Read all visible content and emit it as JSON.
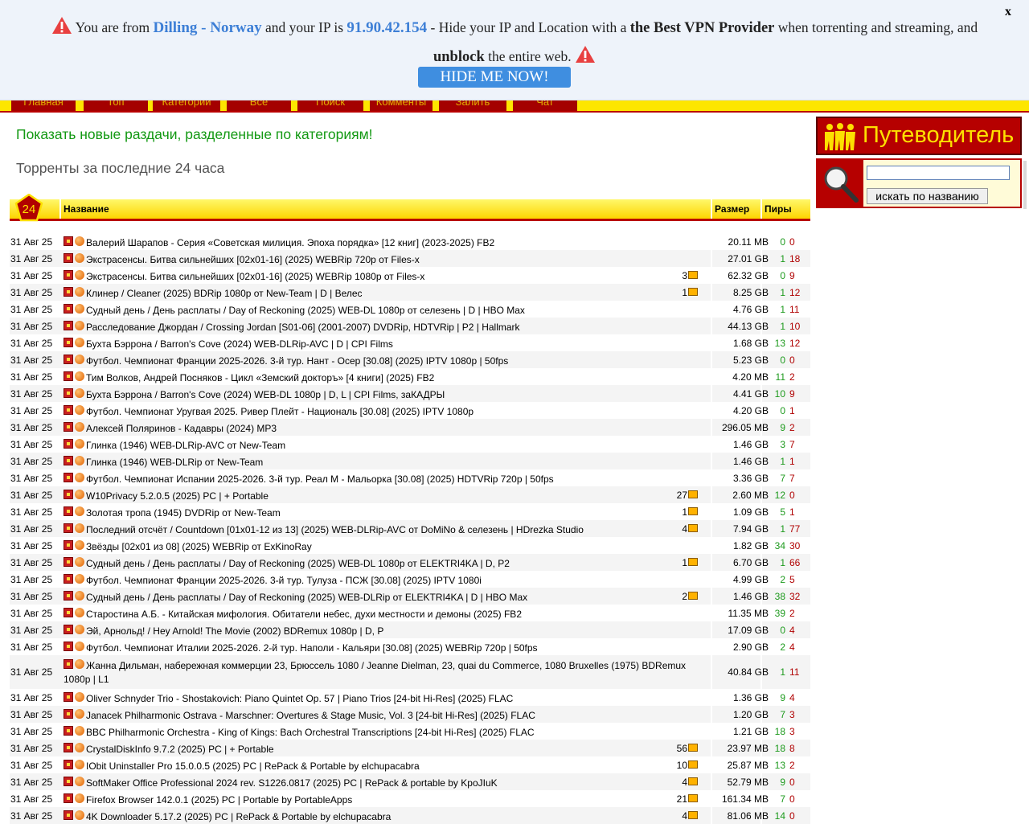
{
  "banner": {
    "part1": "You are from",
    "location": "Dilling - Norway",
    "part2": "and your IP is",
    "ip": "91.90.42.154",
    "part3": "- Hide your IP and Location with a",
    "provider": "the Best VPN Provider",
    "part4": "when torrenting and streaming, and",
    "unblock": "unblock",
    "part5": "the entire web.",
    "button": "HIDE ME NOW!",
    "close": "x"
  },
  "nav": [
    "Главная",
    "Топ",
    "Категории",
    "Все",
    "Поиск",
    "Комменты",
    "Залить",
    "Чат"
  ],
  "main": {
    "new_by_category": "Показать новые раздачи, разделенные по категориям!",
    "heading": "Торренты за последние 24 часа"
  },
  "table": {
    "badge": "24",
    "col_name": "Название",
    "col_size": "Размер",
    "col_peers": "Пиры",
    "rows": [
      {
        "date": "31 Авг 25",
        "title": "Валерий Шарапов - Серия «Советская милиция. Эпоха порядка» [12 книг] (2023-2025) FB2",
        "comments": "",
        "size": "20.11 MB",
        "seed": "0",
        "leech": "0"
      },
      {
        "date": "31 Авг 25",
        "title": "Экстрасенсы. Битва сильнейших [02x01-16] (2025) WEBRip 720p от Files-x",
        "comments": "",
        "size": "27.01 GB",
        "seed": "1",
        "leech": "18"
      },
      {
        "date": "31 Авг 25",
        "title": "Экстрасенсы. Битва сильнейших [02x01-16] (2025) WEBRip 1080p от Files-x",
        "comments": "3",
        "size": "62.32 GB",
        "seed": "0",
        "leech": "9"
      },
      {
        "date": "31 Авг 25",
        "title": "Клинер / Cleaner (2025) BDRip 1080p от New-Team | D | Велес",
        "comments": "1",
        "size": "8.25 GB",
        "seed": "1",
        "leech": "12"
      },
      {
        "date": "31 Авг 25",
        "title": "Судный день / День расплаты / Day of Reckoning (2025) WEB-DL 1080p от селезень | D | HBO Max",
        "comments": "",
        "size": "4.76 GB",
        "seed": "1",
        "leech": "11"
      },
      {
        "date": "31 Авг 25",
        "title": "Расследование Джордан / Crossing Jordan [S01-06] (2001-2007) DVDRip, HDTVRip | P2 | Hallmark",
        "comments": "",
        "size": "44.13 GB",
        "seed": "1",
        "leech": "10"
      },
      {
        "date": "31 Авг 25",
        "title": "Бухта Бэррона / Barron's Cove (2024) WEB-DLRip-AVC | D | CPI Films",
        "comments": "",
        "size": "1.68 GB",
        "seed": "13",
        "leech": "12"
      },
      {
        "date": "31 Авг 25",
        "title": "Футбол. Чемпионат Франции 2025-2026. 3-й тур. Нант - Осер [30.08] (2025) IPTV 1080p | 50fps",
        "comments": "",
        "size": "5.23 GB",
        "seed": "0",
        "leech": "0"
      },
      {
        "date": "31 Авг 25",
        "title": "Тим Волков, Андрей Посняков - Цикл «Земский докторъ» [4 книги] (2025) FB2",
        "comments": "",
        "size": "4.20 MB",
        "seed": "11",
        "leech": "2"
      },
      {
        "date": "31 Авг 25",
        "title": "Бухта Бэррона / Barron's Cove (2024) WEB-DL 1080p | D, L | CPI Films, заКАДРЫ",
        "comments": "",
        "size": "4.41 GB",
        "seed": "10",
        "leech": "9"
      },
      {
        "date": "31 Авг 25",
        "title": "Футбол. Чемпионат Уругвая 2025. Ривер Плейт - Националь [30.08] (2025) IPTV 1080p",
        "comments": "",
        "size": "4.20 GB",
        "seed": "0",
        "leech": "1"
      },
      {
        "date": "31 Авг 25",
        "title": "Алексей Поляринов - Кадавры (2024) MP3",
        "comments": "",
        "size": "296.05 MB",
        "seed": "9",
        "leech": "2"
      },
      {
        "date": "31 Авг 25",
        "title": "Глинка (1946) WEB-DLRip-AVC от New-Team",
        "comments": "",
        "size": "1.46 GB",
        "seed": "3",
        "leech": "7"
      },
      {
        "date": "31 Авг 25",
        "title": "Глинка (1946) WEB-DLRip от New-Team",
        "comments": "",
        "size": "1.46 GB",
        "seed": "1",
        "leech": "1"
      },
      {
        "date": "31 Авг 25",
        "title": "Футбол. Чемпионат Испании 2025-2026. 3-й тур. Реал М - Мальорка [30.08] (2025) HDTVRip 720p | 50fps",
        "comments": "",
        "size": "3.36 GB",
        "seed": "7",
        "leech": "7"
      },
      {
        "date": "31 Авг 25",
        "title": "W10Privacy 5.2.0.5 (2025) PC | + Portable",
        "comments": "27",
        "size": "2.60 MB",
        "seed": "12",
        "leech": "0"
      },
      {
        "date": "31 Авг 25",
        "title": "Золотая тропа (1945) DVDRip от New-Team",
        "comments": "1",
        "size": "1.09 GB",
        "seed": "5",
        "leech": "1"
      },
      {
        "date": "31 Авг 25",
        "title": "Последний отсчёт / Countdown [01x01-12 из 13] (2025) WEB-DLRip-AVC от DoMiNo & селезень | HDrezka Studio",
        "comments": "4",
        "size": "7.94 GB",
        "seed": "1",
        "leech": "77"
      },
      {
        "date": "31 Авг 25",
        "title": "Звёзды [02x01 из 08] (2025) WEBRip от ExKinoRay",
        "comments": "",
        "size": "1.82 GB",
        "seed": "34",
        "leech": "30"
      },
      {
        "date": "31 Авг 25",
        "title": "Судный день / День расплаты / Day of Reckoning (2025) WEB-DL 1080p от ELEKTRI4KA | D, P2",
        "comments": "1",
        "size": "6.70 GB",
        "seed": "1",
        "leech": "66"
      },
      {
        "date": "31 Авг 25",
        "title": "Футбол. Чемпионат Франции 2025-2026. 3-й тур. Тулуза - ПСЖ [30.08] (2025) IPTV 1080i",
        "comments": "",
        "size": "4.99 GB",
        "seed": "2",
        "leech": "5"
      },
      {
        "date": "31 Авг 25",
        "title": "Судный день / День расплаты / Day of Reckoning (2025) WEB-DLRip от ELEKTRI4KA | D | HBO Max",
        "comments": "2",
        "size": "1.46 GB",
        "seed": "38",
        "leech": "32"
      },
      {
        "date": "31 Авг 25",
        "title": "Старостина А.Б. - Китайская мифология. Обитатели небес, духи местности и демоны (2025) FB2",
        "comments": "",
        "size": "11.35 MB",
        "seed": "39",
        "leech": "2"
      },
      {
        "date": "31 Авг 25",
        "title": "Эй, Арнольд! / Hey Arnold! The Movie (2002) BDRemux 1080p | D, P",
        "comments": "",
        "size": "17.09 GB",
        "seed": "0",
        "leech": "4"
      },
      {
        "date": "31 Авг 25",
        "title": "Футбол. Чемпионат Италии 2025-2026. 2-й тур. Наполи - Кальяри [30.08] (2025) WEBRip 720p | 50fps",
        "comments": "",
        "size": "2.90 GB",
        "seed": "2",
        "leech": "4"
      },
      {
        "date": "31 Авг 25",
        "title": "Жанна Дильман, набережная коммерции 23, Брюссель 1080 / Jeanne Dielman, 23, quai du Commerce, 1080 Bruxelles (1975) BDRemux 1080p | L1",
        "comments": "",
        "size": "40.84 GB",
        "seed": "1",
        "leech": "11",
        "tall": true
      },
      {
        "date": "31 Авг 25",
        "title": "Oliver Schnyder Trio - Shostakovich: Piano Quintet Op. 57 | Piano Trios [24-bit Hi-Res] (2025) FLAC",
        "comments": "",
        "size": "1.36 GB",
        "seed": "9",
        "leech": "4"
      },
      {
        "date": "31 Авг 25",
        "title": "Janacek Philharmonic Ostrava - Marschner: Overtures & Stage Music, Vol. 3 [24-bit Hi-Res] (2025) FLAC",
        "comments": "",
        "size": "1.20 GB",
        "seed": "7",
        "leech": "3"
      },
      {
        "date": "31 Авг 25",
        "title": "BBC Philharmonic Orchestra - King of Kings: Bach Orchestral Transcriptions [24-bit Hi-Res] (2025) FLAC",
        "comments": "",
        "size": "1.21 GB",
        "seed": "18",
        "leech": "3"
      },
      {
        "date": "31 Авг 25",
        "title": "CrystalDiskInfo 9.7.2 (2025) PC | + Portable",
        "comments": "56",
        "size": "23.97 MB",
        "seed": "18",
        "leech": "8"
      },
      {
        "date": "31 Авг 25",
        "title": "IObit Uninstaller Pro 15.0.0.5 (2025) PC | RePack & Portable by elchupacabra",
        "comments": "10",
        "size": "25.87 MB",
        "seed": "13",
        "leech": "2"
      },
      {
        "date": "31 Авг 25",
        "title": "SoftMaker Office Professional 2024 rev. S1226.0817 (2025) PC | RePack & portable by KpoJIuK",
        "comments": "4",
        "size": "52.79 MB",
        "seed": "9",
        "leech": "0"
      },
      {
        "date": "31 Авг 25",
        "title": "Firefox Browser 142.0.1 (2025) PC | Portable by PortableApps",
        "comments": "21",
        "size": "161.34 MB",
        "seed": "7",
        "leech": "0"
      },
      {
        "date": "31 Авг 25",
        "title": "4K Downloader 5.17.2 (2025) PC | RePack & Portable by elchupacabra",
        "comments": "4",
        "size": "81.06 MB",
        "seed": "14",
        "leech": "0"
      }
    ]
  },
  "sidebar": {
    "guide": "Путеводитель",
    "search_placeholder": "",
    "search_button": "искать по названию"
  },
  "colors": {
    "banner_bg": "#eef3fa",
    "highlight_blue": "#3d7fd6",
    "nav_red": "#a40000",
    "nav_yellow": "#fde600",
    "link_green": "#139913",
    "seed_green": "#1d9a1d",
    "leech_red": "#b00000"
  }
}
